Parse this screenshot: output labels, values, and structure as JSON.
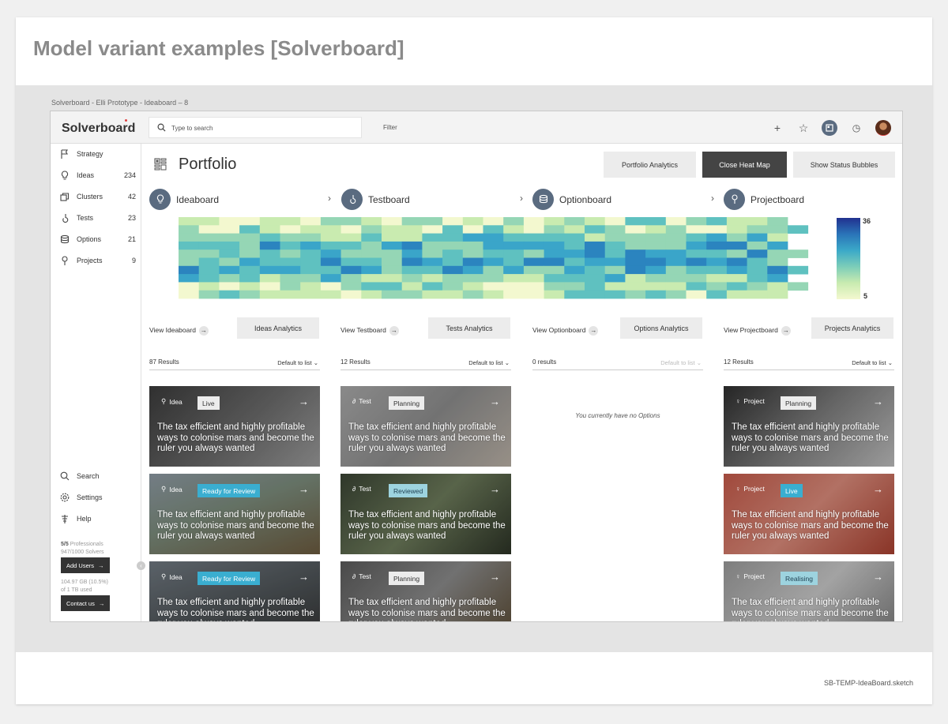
{
  "slide": {
    "title": "Model variant examples [Solverboard]",
    "filename": "SB-TEMP-IdeaBoard.sketch"
  },
  "prototype_label": "Solverboard - Elli Prototype - Ideaboard – 8",
  "topbar": {
    "logo": "Solverboard",
    "search_placeholder": "Type to search",
    "filter_label": "Filter"
  },
  "sidebar": {
    "items": [
      {
        "label": "Strategy",
        "count": "",
        "icon": "flag-icon"
      },
      {
        "label": "Ideas",
        "count": "234",
        "icon": "lightbulb-icon"
      },
      {
        "label": "Clusters",
        "count": "42",
        "icon": "clusters-icon"
      },
      {
        "label": "Tests",
        "count": "23",
        "icon": "flask-icon"
      },
      {
        "label": "Options",
        "count": "21",
        "icon": "stack-icon"
      },
      {
        "label": "Projects",
        "count": "9",
        "icon": "pin-icon"
      }
    ],
    "bottom": [
      {
        "label": "Search",
        "icon": "search-icon"
      },
      {
        "label": "Settings",
        "icon": "gear-icon"
      },
      {
        "label": "Help",
        "icon": "help-icon"
      }
    ],
    "plan": {
      "professionals_count": "5/5",
      "professionals_label": "Professionals",
      "solvers": "947/1000 Solvers",
      "add_users": "Add Users",
      "storage_line1": "104.97 GB (10.5%)",
      "storage_line2": "of 1 TB used",
      "contact": "Contact us"
    }
  },
  "header": {
    "title": "Portfolio",
    "buttons": [
      "Portfolio Analytics",
      "Close Heat Map",
      "Show Status Bubbles"
    ]
  },
  "stages": [
    "Ideaboard",
    "Testboard",
    "Optionboard",
    "Projectboard"
  ],
  "heatmap": {
    "legend_max": "36",
    "legend_min": "5"
  },
  "columns": [
    {
      "view": "View Ideaboard",
      "analytics": "Ideas Analytics",
      "results": "87 Results",
      "sort": "Default to list",
      "empty": "",
      "cards": [
        {
          "kind": "Idea",
          "status": "Live",
          "text": "The tax efficient and highly profitable ways to colonise mars and become the ruler you always wanted"
        },
        {
          "kind": "Idea",
          "status": "Ready for Review",
          "text": "The tax efficient and highly profitable ways to colonise mars and become the ruler you always wanted"
        },
        {
          "kind": "Idea",
          "status": "Ready for Review",
          "text": "The tax efficient and highly profitable ways to colonise mars and become the ruler you always wanted"
        }
      ]
    },
    {
      "view": "View Testboard",
      "analytics": "Tests Analytics",
      "results": "12 Results",
      "sort": "Default to list",
      "empty": "",
      "cards": [
        {
          "kind": "Test",
          "status": "Planning",
          "text": "The tax efficient and highly profitable ways to colonise mars and become the ruler you always wanted"
        },
        {
          "kind": "Test",
          "status": "Reviewed",
          "text": "The tax efficient and highly profitable ways to colonise mars and become the ruler you always wanted"
        },
        {
          "kind": "Test",
          "status": "Planning",
          "text": "The tax efficient and highly profitable ways to colonise mars and become the ruler you always wanted"
        }
      ]
    },
    {
      "view": "View Optionboard",
      "analytics": "Options Analytics",
      "results": "0 results",
      "sort": "Default to list",
      "empty": "You currently have no Options",
      "cards": []
    },
    {
      "view": "View Projectboard",
      "analytics": "Projects Analytics",
      "results": "12 Results",
      "sort": "Default to list",
      "empty": "",
      "cards": [
        {
          "kind": "Project",
          "status": "Planning",
          "text": "The tax efficient and highly profitable ways to colonise mars and become the ruler you always wanted"
        },
        {
          "kind": "Project",
          "status": "Live",
          "text": "The tax efficient and highly profitable ways to colonise mars and become the ruler you always wanted"
        },
        {
          "kind": "Project",
          "status": "Realising",
          "text": "The tax efficient and highly profitable ways to colonise mars and become the ruler you always wanted"
        }
      ]
    }
  ],
  "colors": {
    "accent_blue": "#3aaed0",
    "dark_button": "#444444",
    "stage_circle": "#5a6b80"
  }
}
